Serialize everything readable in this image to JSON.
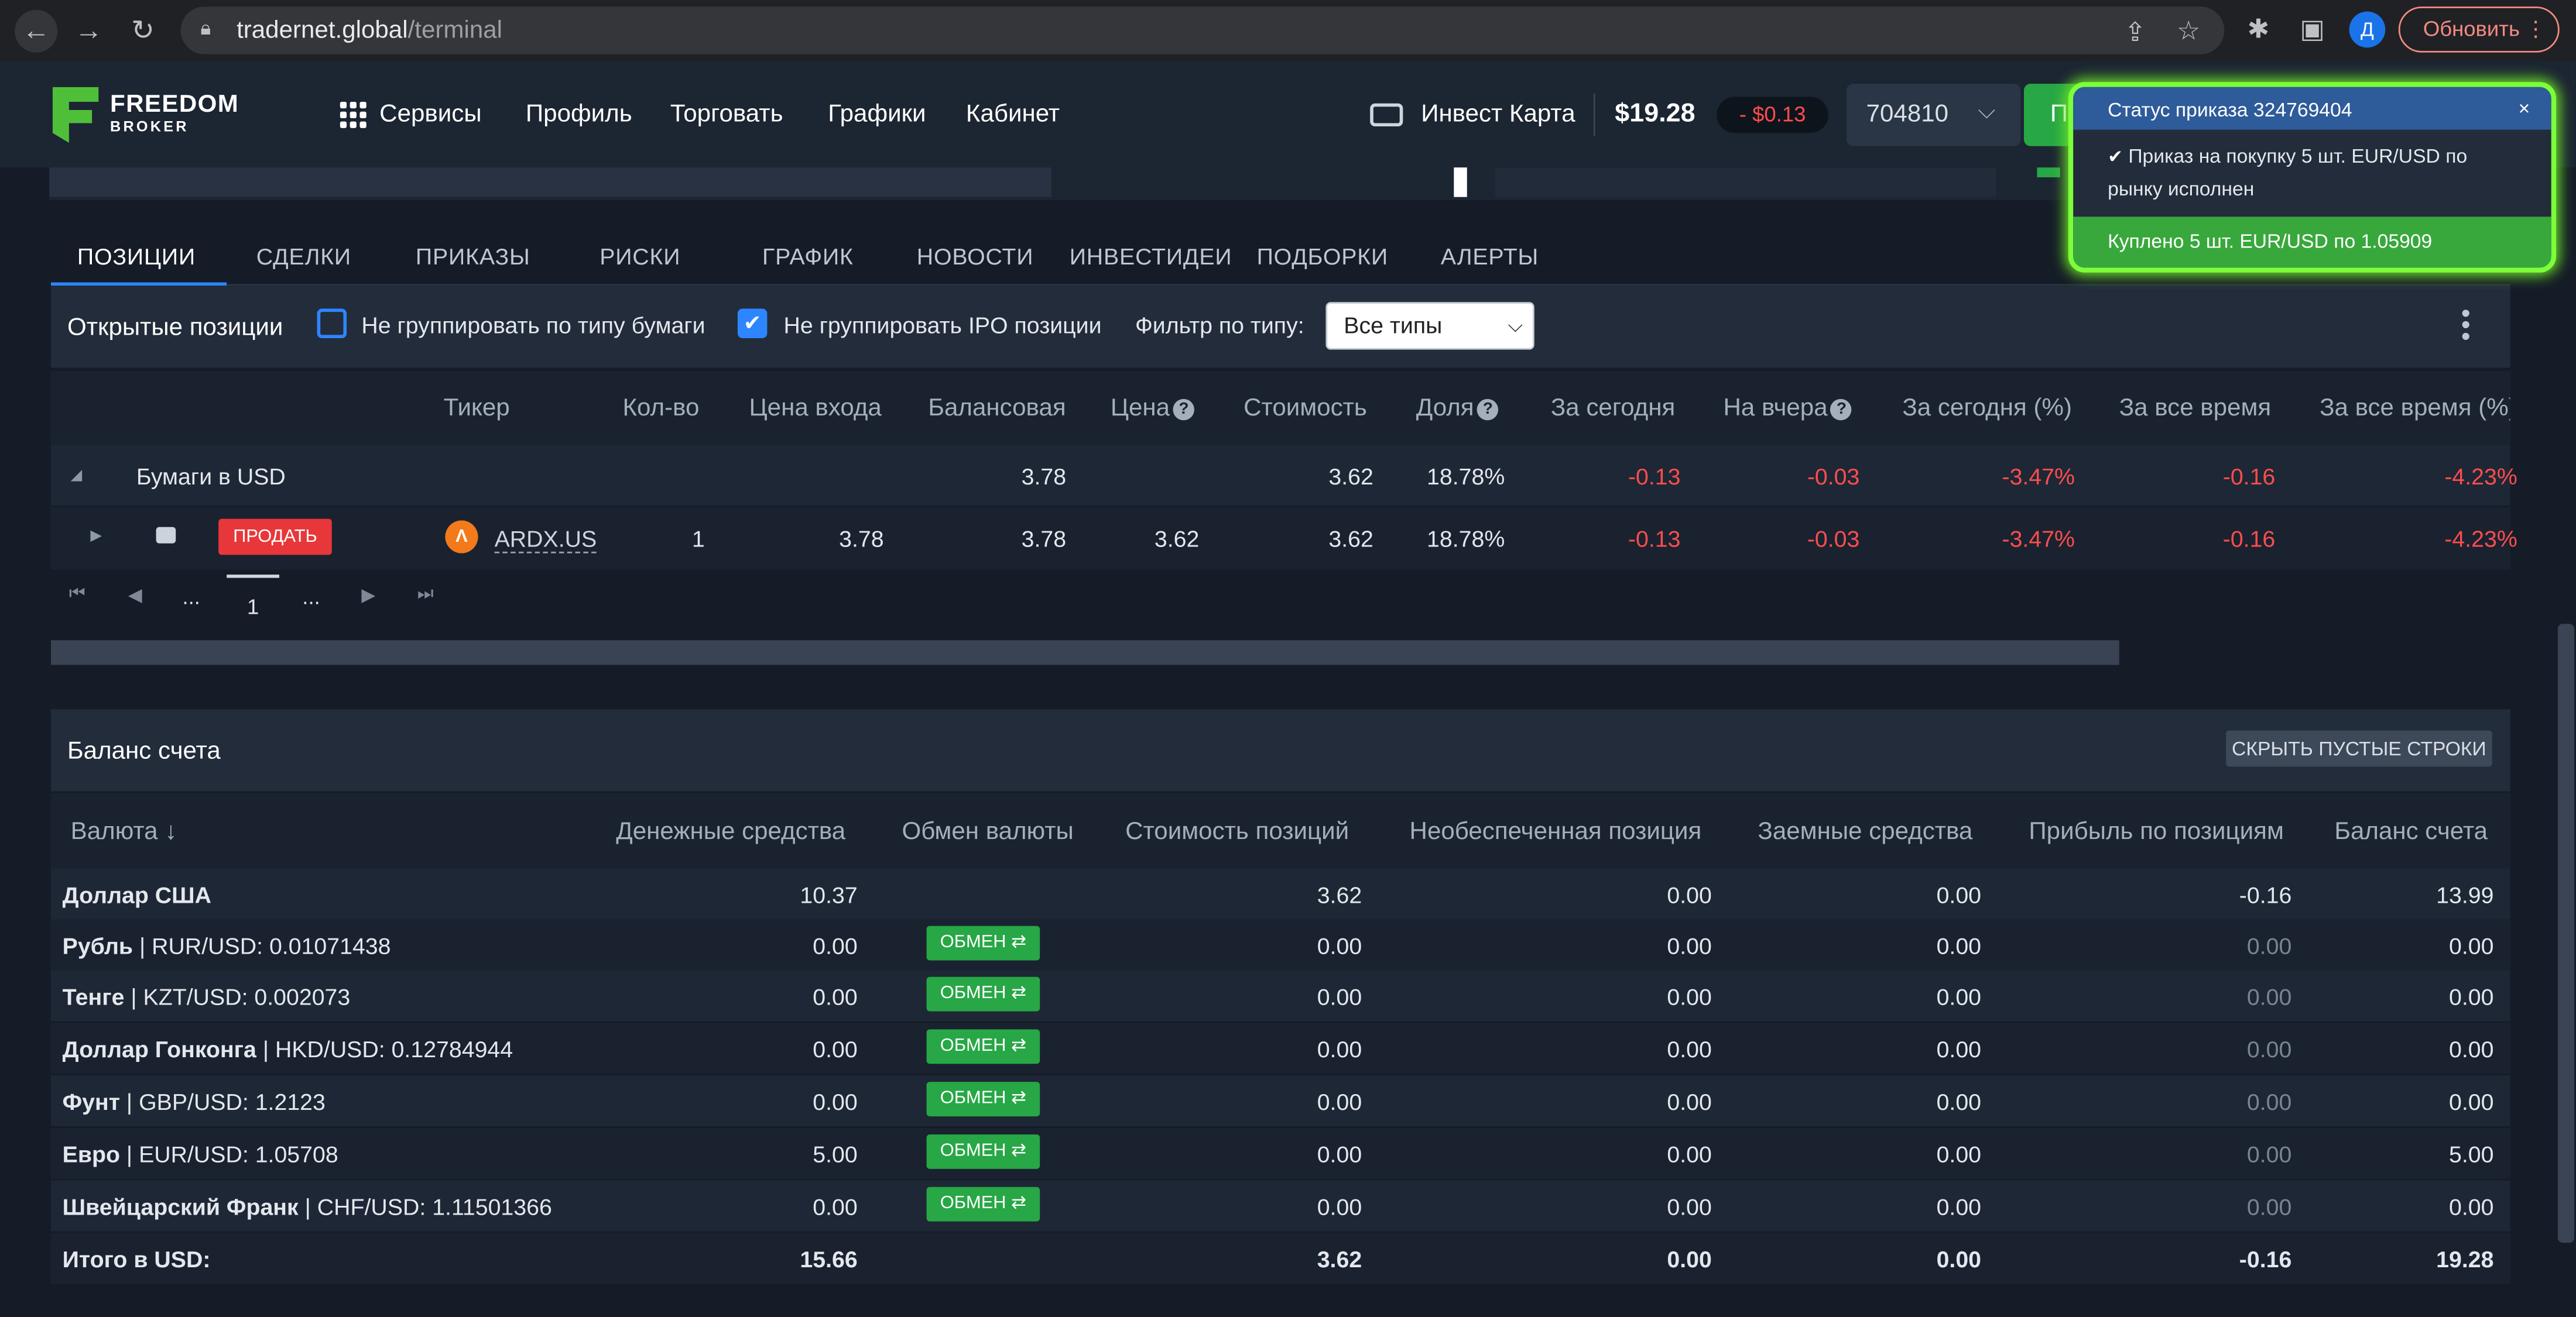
{
  "browser": {
    "url_host": "tradernet.global",
    "url_path": "/terminal",
    "avatar_letter": "Д",
    "update_label": "Обновить"
  },
  "header": {
    "logo_line1": "FREEDOM",
    "logo_line2": "BROKER",
    "nav": [
      "Сервисы",
      "Профиль",
      "Торговать",
      "Графики",
      "Кабинет"
    ],
    "invest_card": "Инвест Карта",
    "balance": "$19.28",
    "balance_delta": "- $0.13",
    "account": "704810",
    "buy_label": "Пок"
  },
  "tabs": [
    "ПОЗИЦИИ",
    "СДЕЛКИ",
    "ПРИКАЗЫ",
    "РИСКИ",
    "ГРАФИК",
    "НОВОСТИ",
    "ИНВЕСТИДЕИ",
    "ПОДБОРКИ",
    "АЛЕРТЫ"
  ],
  "positions": {
    "title": "Открытые позиции",
    "cb1_label": "Не группировать по типу бумаги",
    "cb2_label": "Не группировать IPO позиции",
    "filter_label": "Фильтр по типу:",
    "filter_value": "Все типы",
    "columns": [
      "Тикер",
      "Кол-во",
      "Цена входа",
      "Балансовая",
      "Цена",
      "Стоимость",
      "Доля",
      "За сегодня",
      "На вчера",
      "За сегодня (%)",
      "За все время",
      "За все время (%)"
    ],
    "group": {
      "name": "Бумаги в USD",
      "balance": "3.78",
      "value": "3.62",
      "share": "18.78%",
      "today": "-0.13",
      "yesterday": "-0.03",
      "today_pct": "-3.47%",
      "all_time": "-0.16",
      "all_time_pct": "-4.23%"
    },
    "row": {
      "sell_label": "ПРОДАТЬ",
      "ticker": "ARDX.US",
      "qty": "1",
      "entry": "3.78",
      "balance": "3.78",
      "price": "3.62",
      "value": "3.62",
      "share": "18.78%",
      "today": "-0.13",
      "yesterday": "-0.03",
      "today_pct": "-3.47%",
      "all_time": "-0.16",
      "all_time_pct": "-4.23%"
    },
    "pager": {
      "ellipsis": "...",
      "current": "1"
    }
  },
  "balance": {
    "title": "Баланс счета",
    "hide_empty": "СКРЫТЬ ПУСТЫЕ СТРОКИ",
    "columns": [
      "Валюта",
      "Денежные средства",
      "Обмен валюты",
      "Стоимость позиций",
      "Необеспеченная позиция",
      "Заемные средства",
      "Прибыль по позициям",
      "Баланс счета"
    ],
    "swap_label": "ОБМЕН ⇄",
    "rows": [
      {
        "name": "Доллар США",
        "rate": "",
        "cash": "10.37",
        "positions": "3.62",
        "unsecured": "0.00",
        "borrowed": "0.00",
        "profit": "-0.16",
        "total": "13.99"
      },
      {
        "name": "Рубль",
        "rate": "RUR/USD: 0.01071438",
        "cash": "0.00",
        "positions": "0.00",
        "unsecured": "0.00",
        "borrowed": "0.00",
        "profit": "0.00",
        "total": "0.00"
      },
      {
        "name": "Тенге",
        "rate": "KZT/USD: 0.002073",
        "cash": "0.00",
        "positions": "0.00",
        "unsecured": "0.00",
        "borrowed": "0.00",
        "profit": "0.00",
        "total": "0.00"
      },
      {
        "name": "Доллар Гонконга",
        "rate": "HKD/USD: 0.12784944",
        "cash": "0.00",
        "positions": "0.00",
        "unsecured": "0.00",
        "borrowed": "0.00",
        "profit": "0.00",
        "total": "0.00"
      },
      {
        "name": "Фунт",
        "rate": "GBP/USD: 1.2123",
        "cash": "0.00",
        "positions": "0.00",
        "unsecured": "0.00",
        "borrowed": "0.00",
        "profit": "0.00",
        "total": "0.00"
      },
      {
        "name": "Евро",
        "rate": "EUR/USD: 1.05708",
        "cash": "5.00",
        "positions": "0.00",
        "unsecured": "0.00",
        "borrowed": "0.00",
        "profit": "0.00",
        "total": "5.00"
      },
      {
        "name": "Швейцарский Франк",
        "rate": "CHF/USD: 1.11501366",
        "cash": "0.00",
        "positions": "0.00",
        "unsecured": "0.00",
        "borrowed": "0.00",
        "profit": "0.00",
        "total": "0.00"
      }
    ],
    "total": {
      "label": "Итого в USD:",
      "cash": "15.66",
      "positions": "3.62",
      "unsecured": "0.00",
      "borrowed": "0.00",
      "profit": "-0.16",
      "total": "19.28"
    }
  },
  "toast": {
    "title": "Статус приказа 324769404",
    "close": "×",
    "body": "Приказ на покупку 5 шт. EUR/USD по рынку исполнен",
    "footer": "Куплено 5 шт. EUR/USD по 1.05909"
  },
  "colors": {
    "accent": "#2d86ff",
    "negative": "#ff4d4d",
    "buy": "#27a745",
    "sell": "#e8373a"
  }
}
